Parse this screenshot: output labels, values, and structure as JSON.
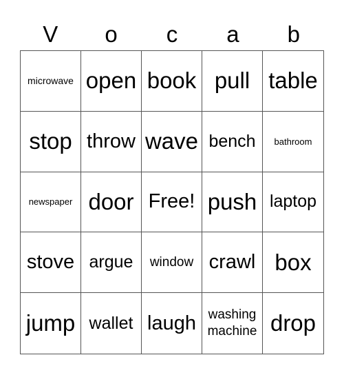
{
  "title_letters": [
    "V",
    "o",
    "c",
    "a",
    "b"
  ],
  "cells": [
    {
      "text": "microwave",
      "size": "xs"
    },
    {
      "text": "open",
      "size": "xl"
    },
    {
      "text": "book",
      "size": "xl"
    },
    {
      "text": "pull",
      "size": "xl"
    },
    {
      "text": "table",
      "size": "xl"
    },
    {
      "text": "stop",
      "size": "xl"
    },
    {
      "text": "throw",
      "size": "l"
    },
    {
      "text": "wave",
      "size": "xl"
    },
    {
      "text": "bench",
      "size": "m"
    },
    {
      "text": "bathroom",
      "size": "xxs"
    },
    {
      "text": "newspaper",
      "size": "xxs"
    },
    {
      "text": "door",
      "size": "xl"
    },
    {
      "text": "Free!",
      "size": "l"
    },
    {
      "text": "push",
      "size": "xl"
    },
    {
      "text": "laptop",
      "size": "m"
    },
    {
      "text": "stove",
      "size": "l"
    },
    {
      "text": "argue",
      "size": "m"
    },
    {
      "text": "window",
      "size": "s"
    },
    {
      "text": "crawl",
      "size": "l"
    },
    {
      "text": "box",
      "size": "xl"
    },
    {
      "text": "jump",
      "size": "xl"
    },
    {
      "text": "wallet",
      "size": "m"
    },
    {
      "text": "laugh",
      "size": "l"
    },
    {
      "text": "washing machine",
      "size": "wrap"
    },
    {
      "text": "drop",
      "size": "xl"
    }
  ]
}
